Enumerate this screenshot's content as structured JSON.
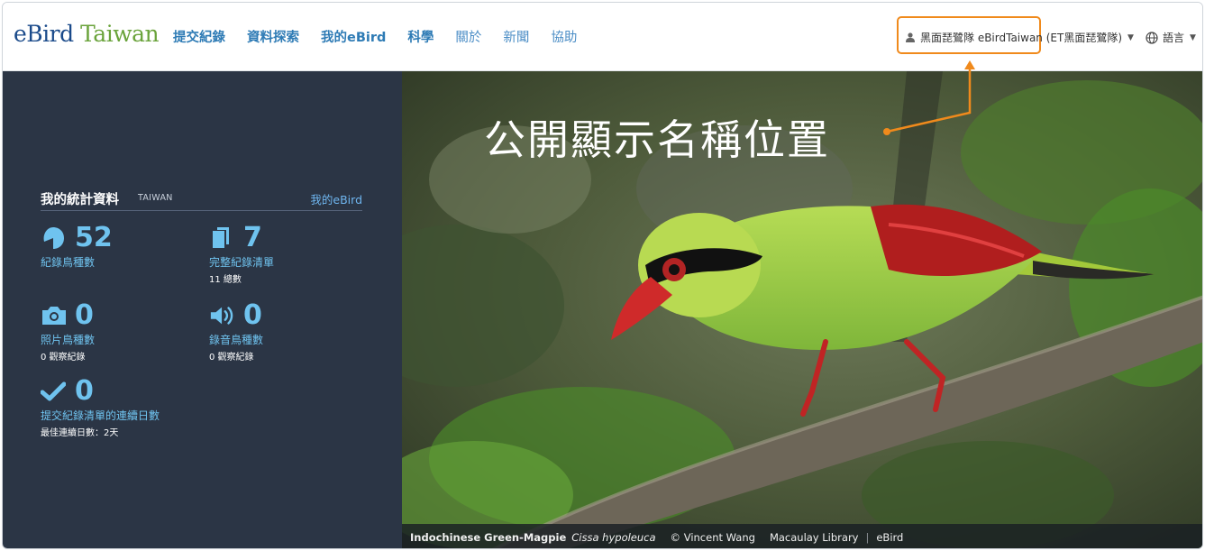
{
  "header": {
    "logo_ebird": "eBird",
    "logo_region": "Taiwan",
    "nav": [
      {
        "label": "提交紀錄",
        "weight": "bold"
      },
      {
        "label": "資料探索",
        "weight": "bold"
      },
      {
        "label": "我的eBird",
        "weight": "bold"
      },
      {
        "label": "科學",
        "weight": "bold"
      },
      {
        "label": "關於",
        "weight": "light"
      },
      {
        "label": "新聞",
        "weight": "light"
      },
      {
        "label": "協助",
        "weight": "light"
      }
    ],
    "user_label": "黑面琵鷺隊 eBirdTaiwan (ET黑面琵鷺隊)",
    "language_label": "語言"
  },
  "stats": {
    "title": "我的統計資料",
    "region": "TAIWAN",
    "link": "我的eBird",
    "items": [
      {
        "icon": "species-icon",
        "value": "52",
        "label": "紀錄鳥種數",
        "sub": ""
      },
      {
        "icon": "checklist-icon",
        "value": "7",
        "label": "完整紀錄清單",
        "sub": "11 總數"
      },
      {
        "icon": "camera-icon",
        "value": "0",
        "label": "照片鳥種數",
        "sub": "0 觀察紀錄"
      },
      {
        "icon": "audio-icon",
        "value": "0",
        "label": "錄音鳥種數",
        "sub": "0 觀察紀錄"
      },
      {
        "icon": "checkmark-icon",
        "value": "0",
        "label": "提交紀錄清單的連續日數",
        "sub": "最佳連續日數：2天"
      }
    ]
  },
  "hero": {
    "annotation": "公開顯示名稱位置",
    "annotation_color": "#f08a1c",
    "caption_species": "Indochinese Green-Magpie",
    "caption_scientific": "Cissa hypoleuca",
    "caption_credit": "© Vincent Wang",
    "caption_library": "Macaulay Library",
    "caption_sep": "|",
    "caption_brand": "eBird"
  },
  "colors": {
    "accent_blue": "#2e7bb5",
    "panel_bg": "#2b3545",
    "stat_blue": "#6fc3ef",
    "highlight_orange": "#f08a1c"
  }
}
